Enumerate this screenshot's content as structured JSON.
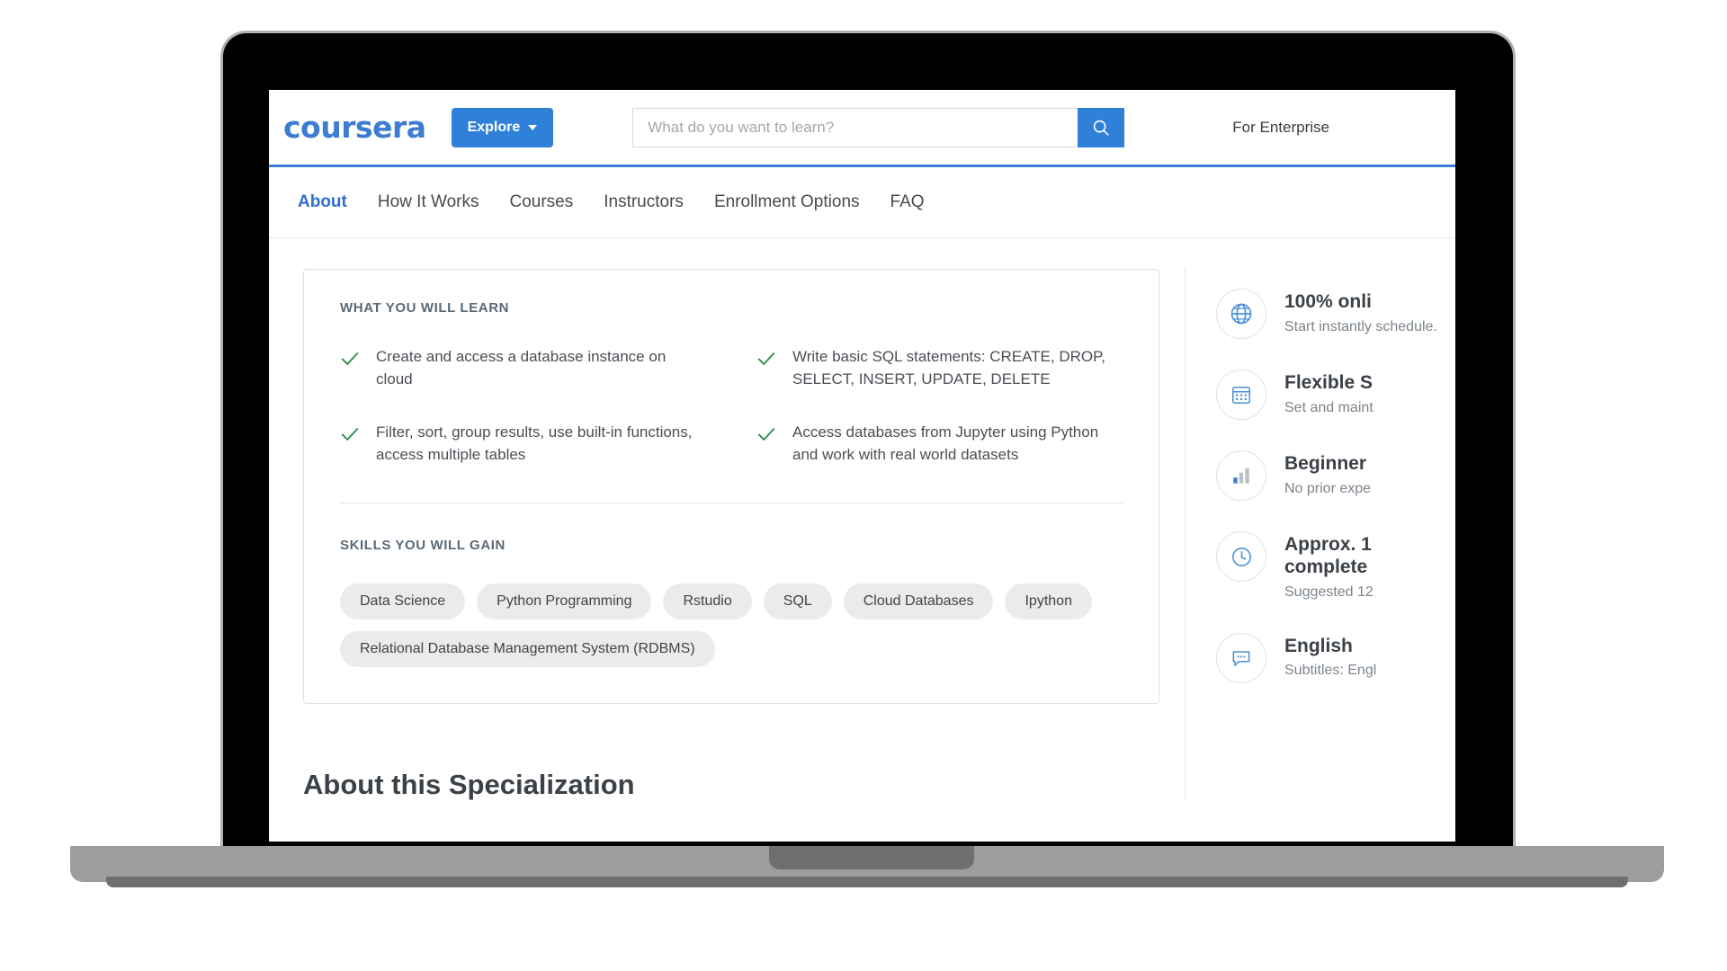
{
  "header": {
    "logo_text": "coursera",
    "explore_label": "Explore",
    "explore_caret": "chevron-down-icon",
    "search_placeholder": "What do you want to learn?",
    "search_value": "",
    "search_icon": "search-icon",
    "for_enterprise_label": "For Enterprise",
    "accent_color": "#2f80d9",
    "logo_color": "#3d7cd3"
  },
  "sub_nav": {
    "tabs": [
      {
        "label": "About",
        "active": true
      },
      {
        "label": "How It Works",
        "active": false
      },
      {
        "label": "Courses",
        "active": false
      },
      {
        "label": "Instructors",
        "active": false
      },
      {
        "label": "Enrollment Options",
        "active": false
      },
      {
        "label": "FAQ",
        "active": false
      }
    ],
    "active_color": "#2f6fd0"
  },
  "card": {
    "learn_title": "WHAT YOU WILL LEARN",
    "learn_items": [
      "Create and access a database instance on cloud",
      "Write basic SQL statements: CREATE, DROP, SELECT, INSERT, UPDATE, DELETE",
      "Filter, sort, group results, use built-in functions, access multiple tables",
      "Access databases from Jupyter using Python and work with real world datasets"
    ],
    "check_icon": "check-icon",
    "check_color": "#2e8b4f",
    "skills_title": "SKILLS YOU WILL GAIN",
    "skills": [
      "Data Science",
      "Python Programming",
      "Rstudio",
      "SQL",
      "Cloud Databases",
      "Ipython",
      "Relational Database Management System (RDBMS)"
    ]
  },
  "about_section": {
    "heading": "About this Specialization"
  },
  "sidebar": {
    "items": [
      {
        "icon": "globe-icon",
        "title": "100% onli",
        "subtitle": "Start instantly schedule."
      },
      {
        "icon": "calendar-icon",
        "title": "Flexible S",
        "subtitle": "Set and maint"
      },
      {
        "icon": "bar-chart-icon",
        "title": "Beginner",
        "subtitle": "No prior expe"
      },
      {
        "icon": "clock-icon",
        "title": "Approx. 1",
        "title2": "complete",
        "subtitle": "Suggested 12"
      },
      {
        "icon": "speech-bubble-icon",
        "title": "English",
        "subtitle": "Subtitles: Engl"
      }
    ],
    "icon_color": "#4a90d9"
  }
}
